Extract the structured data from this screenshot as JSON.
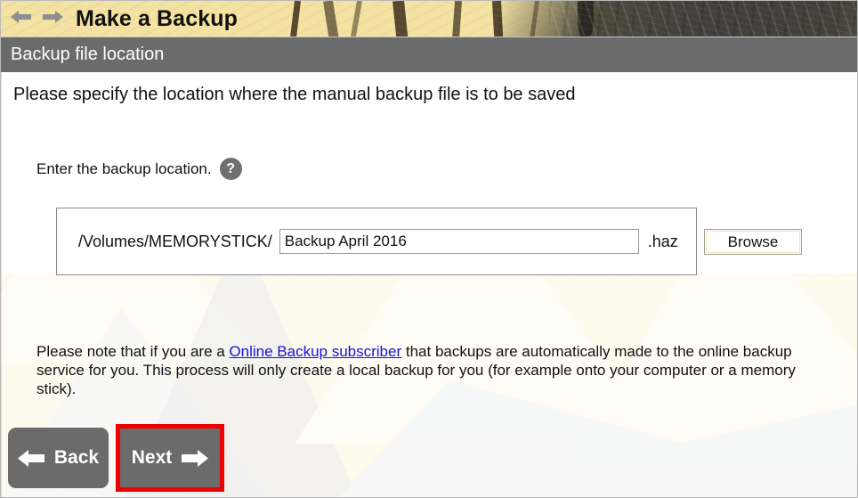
{
  "window": {
    "title": "Make a Backup",
    "subtitle": "Backup file location"
  },
  "nav_arrows": {
    "back_icon": "arrow-left-icon",
    "forward_icon": "arrow-right-icon"
  },
  "main": {
    "instruction": "Please specify the location where the manual backup file is to be saved",
    "field_label": "Enter the backup location.",
    "help_icon_label": "?",
    "path_prefix": "/Volumes/MEMORYSTICK/",
    "filename_value": "Backup April 2016",
    "filename_placeholder": "Backup April 2016",
    "file_extension": ".haz",
    "browse_label": "Browse"
  },
  "note": {
    "part1": "Please note that if you are a ",
    "link": "Online Backup subscriber",
    "part2": " that backups are automatically made to the online backup service for you. This process will only create a local backup for you (for example onto your computer or a memory stick)."
  },
  "footer": {
    "back_label": "Back",
    "next_label": "Next",
    "back_arrow_icon": "arrow-left-icon",
    "next_arrow_icon": "arrow-right-icon"
  },
  "colors": {
    "header_paint": "#f3e2a2",
    "subtitle_bar": "#6b6b6b",
    "button_grey": "#6b6b6b",
    "highlight_red": "#ee0000",
    "link_blue": "#1414d6",
    "browse_inner_border": "#f3e2b4"
  }
}
